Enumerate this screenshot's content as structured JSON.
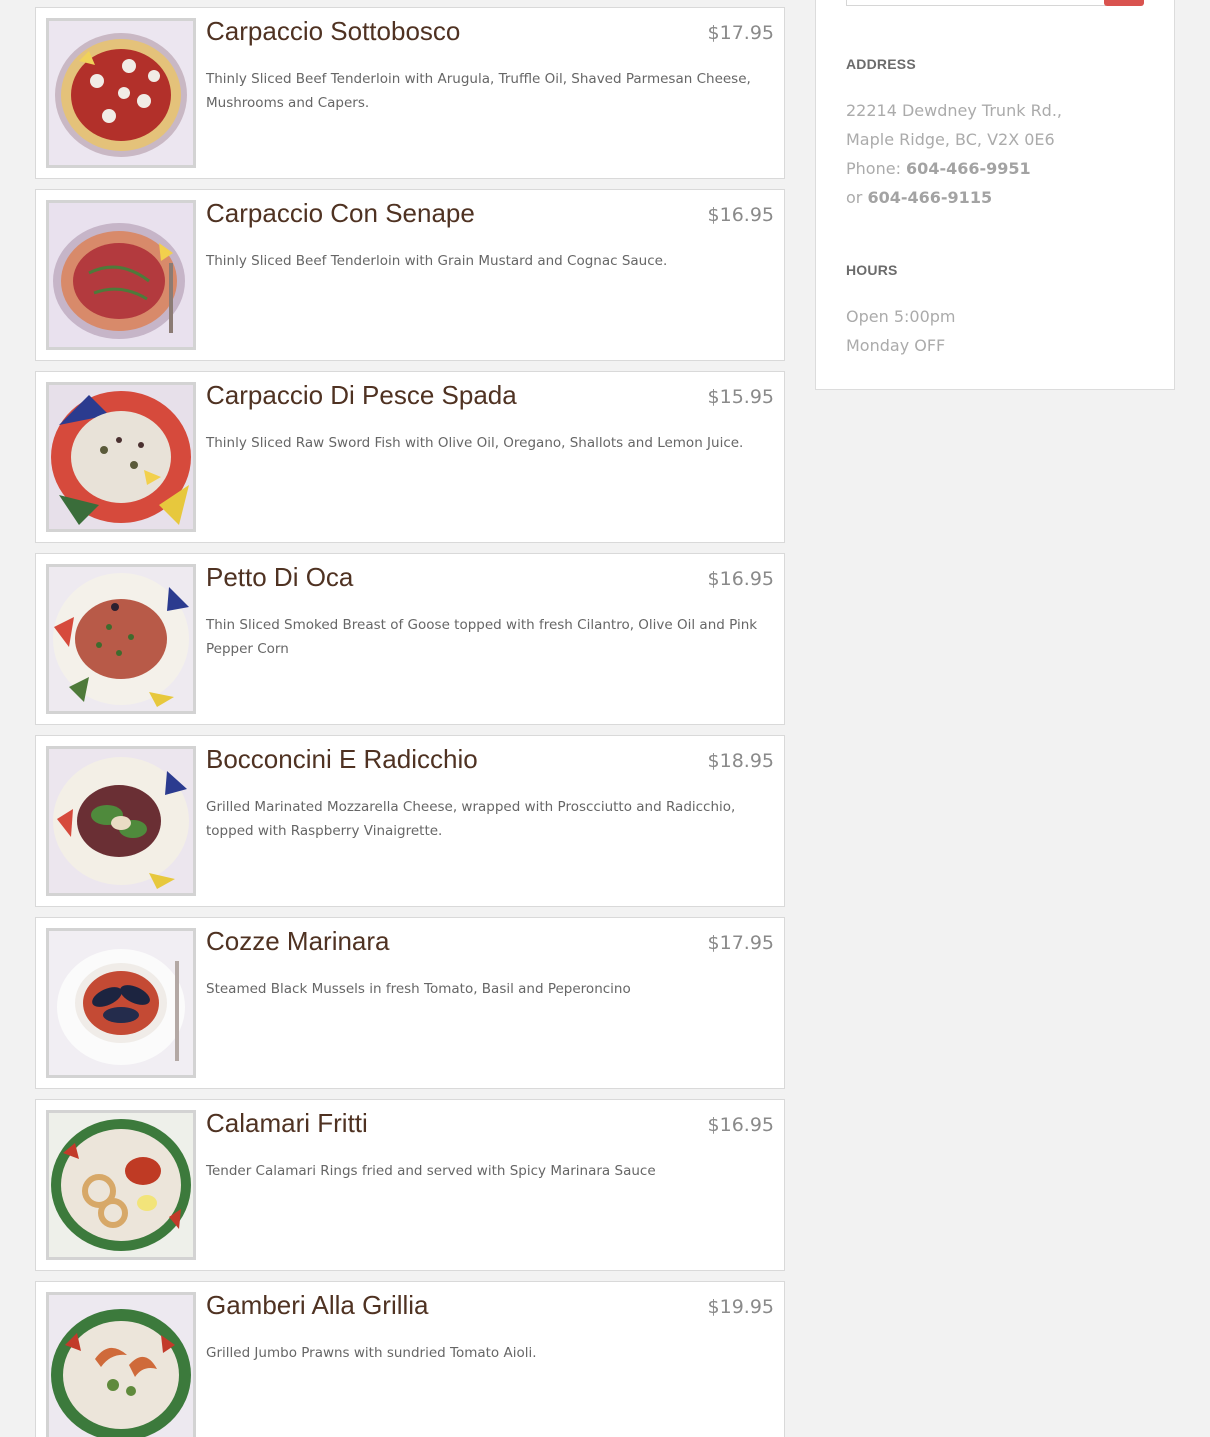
{
  "menu_items": [
    {
      "title": "Carpaccio Sottobosco",
      "price": "$17.95",
      "description": "Thinly Sliced Beef Tenderloin with Arugula, Truffle Oil, Shaved Parmesan Cheese, Mushrooms and Capers."
    },
    {
      "title": "Carpaccio Con Senape",
      "price": "$16.95",
      "description": "Thinly Sliced Beef Tenderloin with Grain Mustard and Cognac Sauce."
    },
    {
      "title": "Carpaccio Di Pesce Spada",
      "price": "$15.95",
      "description": "Thinly Sliced Raw Sword Fish with Olive Oil, Oregano, Shallots and Lemon Juice."
    },
    {
      "title": "Petto Di Oca",
      "price": "$16.95",
      "description": "Thin Sliced Smoked Breast of Goose topped with fresh Cilantro, Olive Oil and Pink Pepper Corn"
    },
    {
      "title": "Bocconcini E Radicchio",
      "price": "$18.95",
      "description": "Grilled Marinated Mozzarella Cheese, wrapped with Proscciutto and Radicchio, topped with Raspberry Vinaigrette."
    },
    {
      "title": "Cozze Marinara",
      "price": "$17.95",
      "description": "Steamed Black Mussels in fresh Tomato, Basil and Peperoncino"
    },
    {
      "title": "Calamari Fritti",
      "price": "$16.95",
      "description": "Tender Calamari Rings fried and served with Spicy Marinara Sauce"
    },
    {
      "title": "Gamberi Alla Grillia",
      "price": "$19.95",
      "description": "Grilled Jumbo Prawns with sundried Tomato Aioli."
    }
  ],
  "sidebar": {
    "address_heading": "ADDRESS",
    "address_line1": "22214 Dewdney Trunk Rd.,",
    "address_line2": "Maple Ridge, BC, V2X 0E6",
    "phone_label": "Phone:",
    "phone_primary": "604-466-9951",
    "phone_or": "or",
    "phone_secondary": "604-466-9115",
    "hours_heading": "HOURS",
    "hours_line1": "Open 5:00pm",
    "hours_line2": "Monday OFF"
  },
  "colors": {
    "title": "#4f3222",
    "price": "#8a8a8a",
    "search_button": "#d9534f"
  }
}
